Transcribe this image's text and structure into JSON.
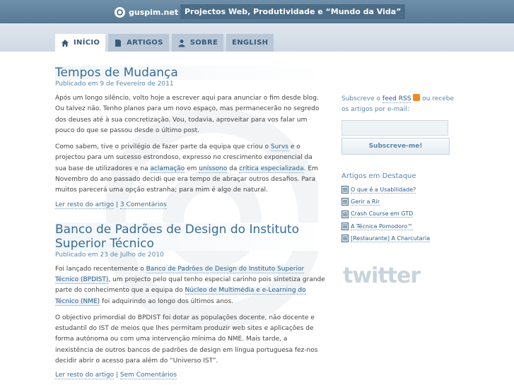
{
  "site": {
    "logo_text": "guspim.net",
    "tagline": "Projectos Web, Produtividade e “Mundo da Vida”"
  },
  "nav": {
    "items": [
      {
        "label": "INÍCIO",
        "icon": "home-icon"
      },
      {
        "label": "ARTIGOS",
        "icon": "document-icon"
      },
      {
        "label": "SOBRE",
        "icon": "person-icon"
      },
      {
        "label": "ENGLISH",
        "icon": ""
      }
    ]
  },
  "posts": [
    {
      "title": "Tempos de Mudança",
      "meta": "Publicado em 9 de Fevereiro de 2011",
      "p1": "Após um longo silêncio, volto hoje a escrever aqui para anunciar o fim desde blog. Ou talvez não. Tenho planos para um novo espaço, mas permanecerão no segredo dos deuses até à sua concretização. Vou, todavia, aproveitar para vos falar um pouco do que se passou desde o último post.",
      "p2": {
        "t1": "Como sabem, tive o privilégio de fazer parte da equipa que criou o ",
        "l1": "Survs",
        "t2": " e o projectou para um sucesso estrondoso, expresso no crescimento exponencial da sua base de utilizadores e na ",
        "l2": "aclamação",
        "t3": " em ",
        "l3": "uníssono",
        "t4": " da ",
        "l4": "crítica especializada",
        "t5": ". Em Novembro do ano passado decidi que era tempo de abraçar outros desafios. Para muitos parecerá uma opção estranha; para mim é algo de natural."
      },
      "read_more": "Ler resto do artigo",
      "separator": " | ",
      "comments": "3 Comentários"
    },
    {
      "title": "Banco de Padrões de Design do Instituto Superior Técnico",
      "meta": "Publicado em 23 de Julho de 2010",
      "p1": {
        "t1": "Foi lançado recentemente o ",
        "l1": "Banco de Padrões de Design do Instituto Superior Técnico (BPDIST)",
        "t2": ", um projecto pelo qual tenho especial carinho pois sintetiza grande parte do conhecimento que a equipa do ",
        "l2": "Núcleo de Multimédia e e-Learning do Técnico (NME)",
        "t3": " foi adquirindo ao longo dos últimos anos."
      },
      "p2": "O objectivo primordial do BPDIST foi dotar as populações docente, não docente e estudantil do IST de meios que lhes permitam produzir web sites e aplicações de forma autónoma ou com uma intervenção mínima do NME. Mais tarde, a inexistência de outros bancos de padrões de design em língua portuguesa fez-nos decidir abrir o acesso para além do “Universo IST”.",
      "read_more": "Ler resto do artigo",
      "separator": " | ",
      "comments": "Sem Comentários"
    }
  ],
  "sidebar": {
    "subscribe_prefix": "Subscreve o ",
    "feed_link": "feed RSS",
    "subscribe_suffix": " ou recebe os artigos por e-mail:",
    "email_placeholder": "",
    "subscribe_button": "Subscreve-me!",
    "featured_title": "Artigos em Destaque",
    "featured": [
      "O que é a Usabilidade?",
      "Gerir a Rir",
      "Crash Course em GTD",
      "A Técnica Pomodoro™",
      "[Restaurante] A Charcutaria"
    ],
    "twitter": "twitter"
  },
  "colors": {
    "topbar": "#587a95",
    "link": "#2b5d88",
    "accent": "#3a6b94",
    "rss": "#f08a24"
  }
}
